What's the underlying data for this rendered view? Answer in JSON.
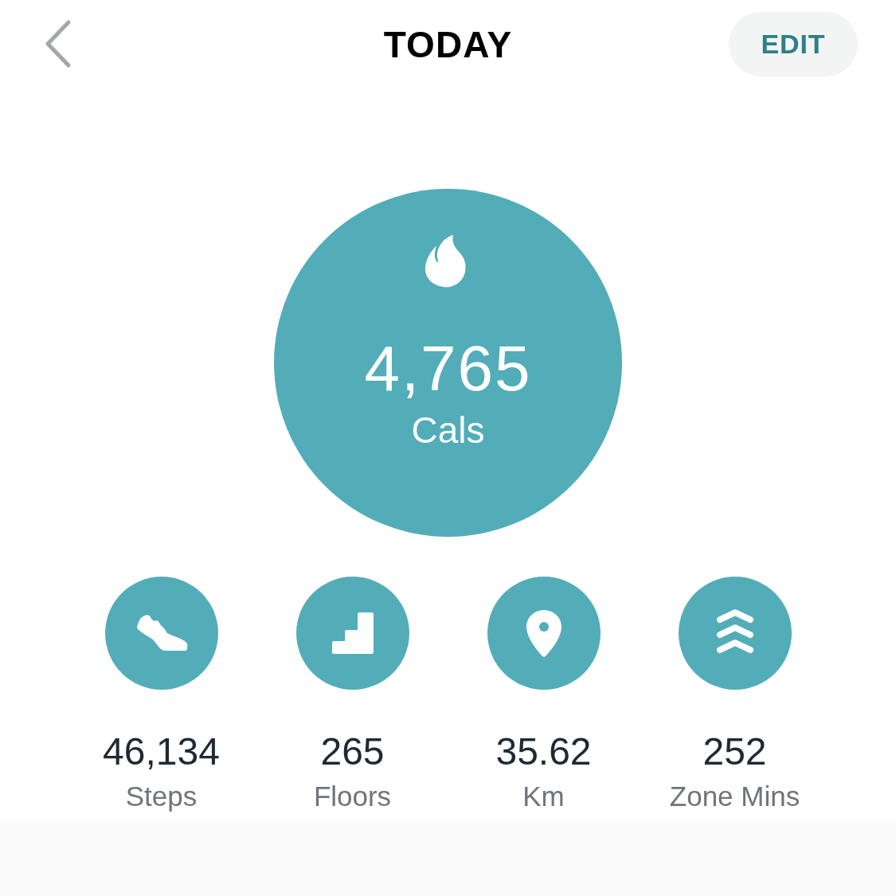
{
  "header": {
    "title": "TODAY",
    "edit_button": "EDIT"
  },
  "main_stat": {
    "value": "4,765",
    "unit": "Cals"
  },
  "stats": [
    {
      "kind": "steps",
      "value": "46,134",
      "label": "Steps"
    },
    {
      "kind": "floors",
      "value": "265",
      "label": "Floors"
    },
    {
      "kind": "distance",
      "value": "35.62",
      "label": "Km"
    },
    {
      "kind": "zone",
      "value": "252",
      "label": "Zone Mins"
    }
  ]
}
